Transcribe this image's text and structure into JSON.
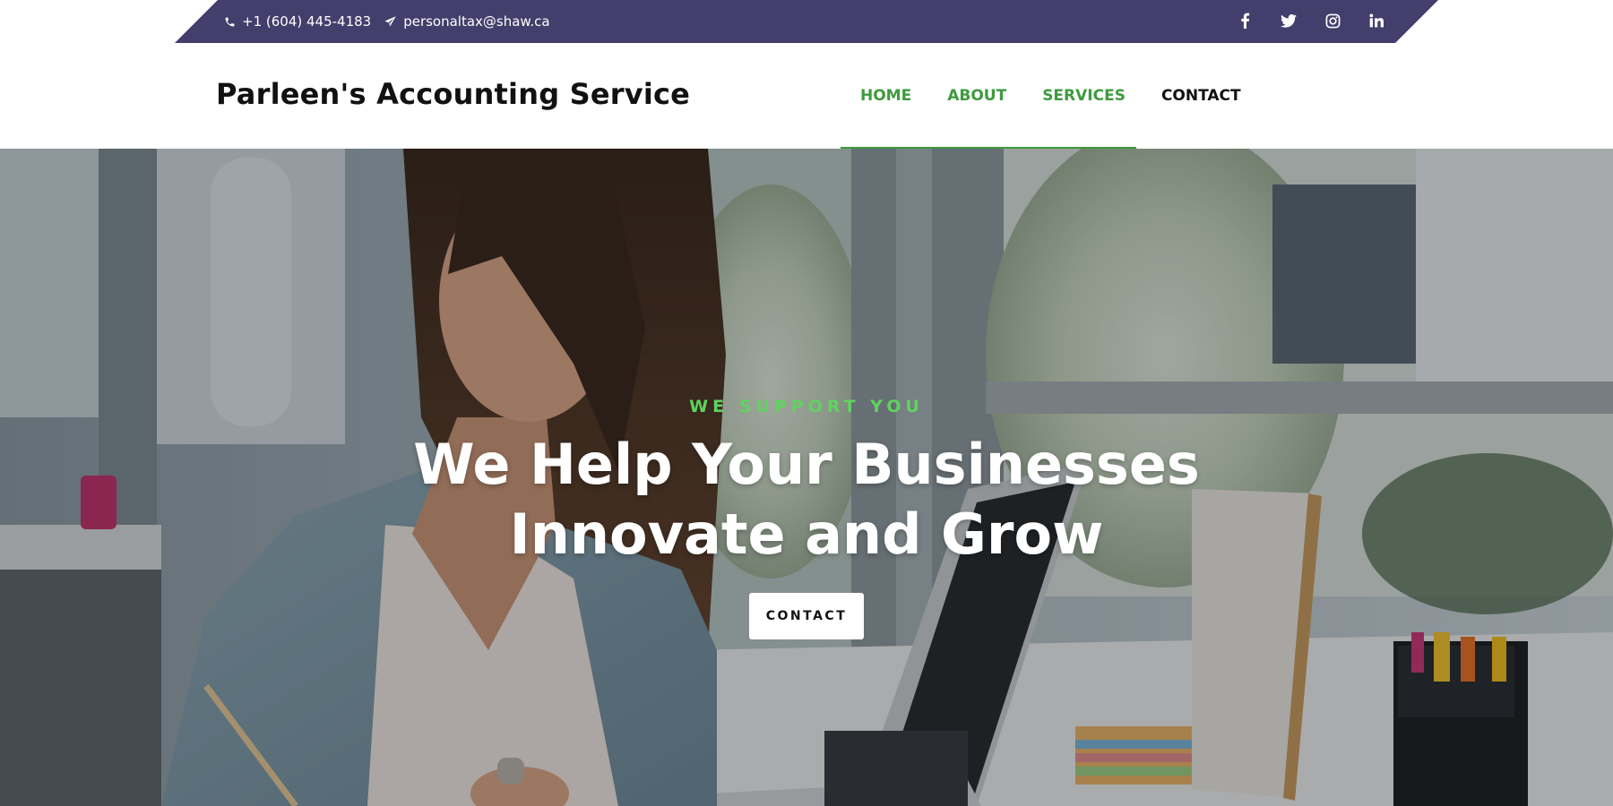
{
  "topbar": {
    "phone": "+1 (604) 445-4183",
    "email": "personaltax@shaw.ca",
    "phone_icon": "phone-icon",
    "email_icon": "paper-plane-icon",
    "background_color": "#433e6b",
    "social": [
      {
        "name": "facebook",
        "icon": "facebook-icon"
      },
      {
        "name": "twitter",
        "icon": "twitter-icon"
      },
      {
        "name": "instagram",
        "icon": "instagram-icon"
      },
      {
        "name": "linkedin",
        "icon": "linkedin-icon"
      }
    ]
  },
  "header": {
    "logo": "Parleen's Accounting Service",
    "nav": [
      {
        "label": "HOME",
        "active": true
      },
      {
        "label": "ABOUT",
        "active": false
      },
      {
        "label": "SERVICES",
        "active": false
      },
      {
        "label": "CONTACT",
        "active": false
      }
    ],
    "accent_color": "#3e9a3e"
  },
  "hero": {
    "eyebrow": "WE SUPPORT YOU",
    "headline_line1": "We Help Your Businesses",
    "headline_line2": "Innovate and Grow",
    "cta_label": "CONTACT",
    "eyebrow_color": "#5fd35f"
  }
}
